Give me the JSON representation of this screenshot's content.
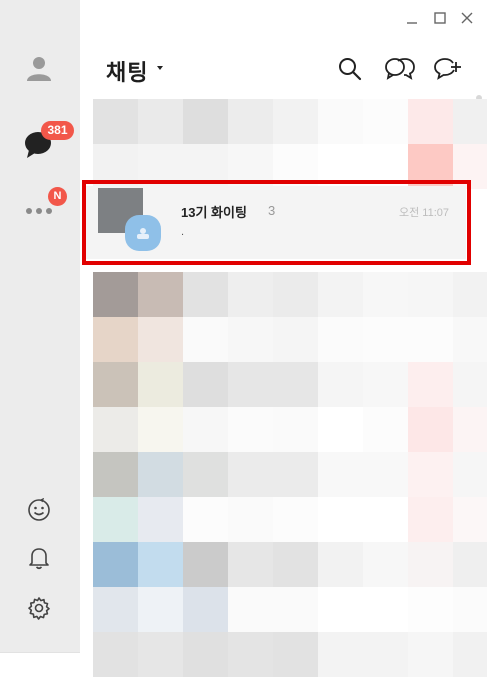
{
  "window": {
    "controls": [
      "minimize-icon",
      "maximize-icon",
      "close-icon"
    ]
  },
  "sidebar": {
    "items": [
      {
        "icon": "profile-icon"
      },
      {
        "icon": "chat-bubble-icon",
        "badge": "381"
      },
      {
        "icon": "more-icon",
        "badge": "N"
      }
    ],
    "bottom_items": [
      {
        "icon": "emoticon-icon"
      },
      {
        "icon": "bell-icon"
      },
      {
        "icon": "gear-icon"
      }
    ],
    "badge_color": "#f2574a"
  },
  "header": {
    "title": "채팅",
    "icons": [
      "search-icon",
      "open-chat-icon",
      "new-chat-icon"
    ]
  },
  "chat_list": {
    "highlighted": {
      "name": "13기 화이팅",
      "member_count": "3",
      "last_message": ".",
      "time": "오전 11:07"
    },
    "highlight_color": "#e10000"
  }
}
